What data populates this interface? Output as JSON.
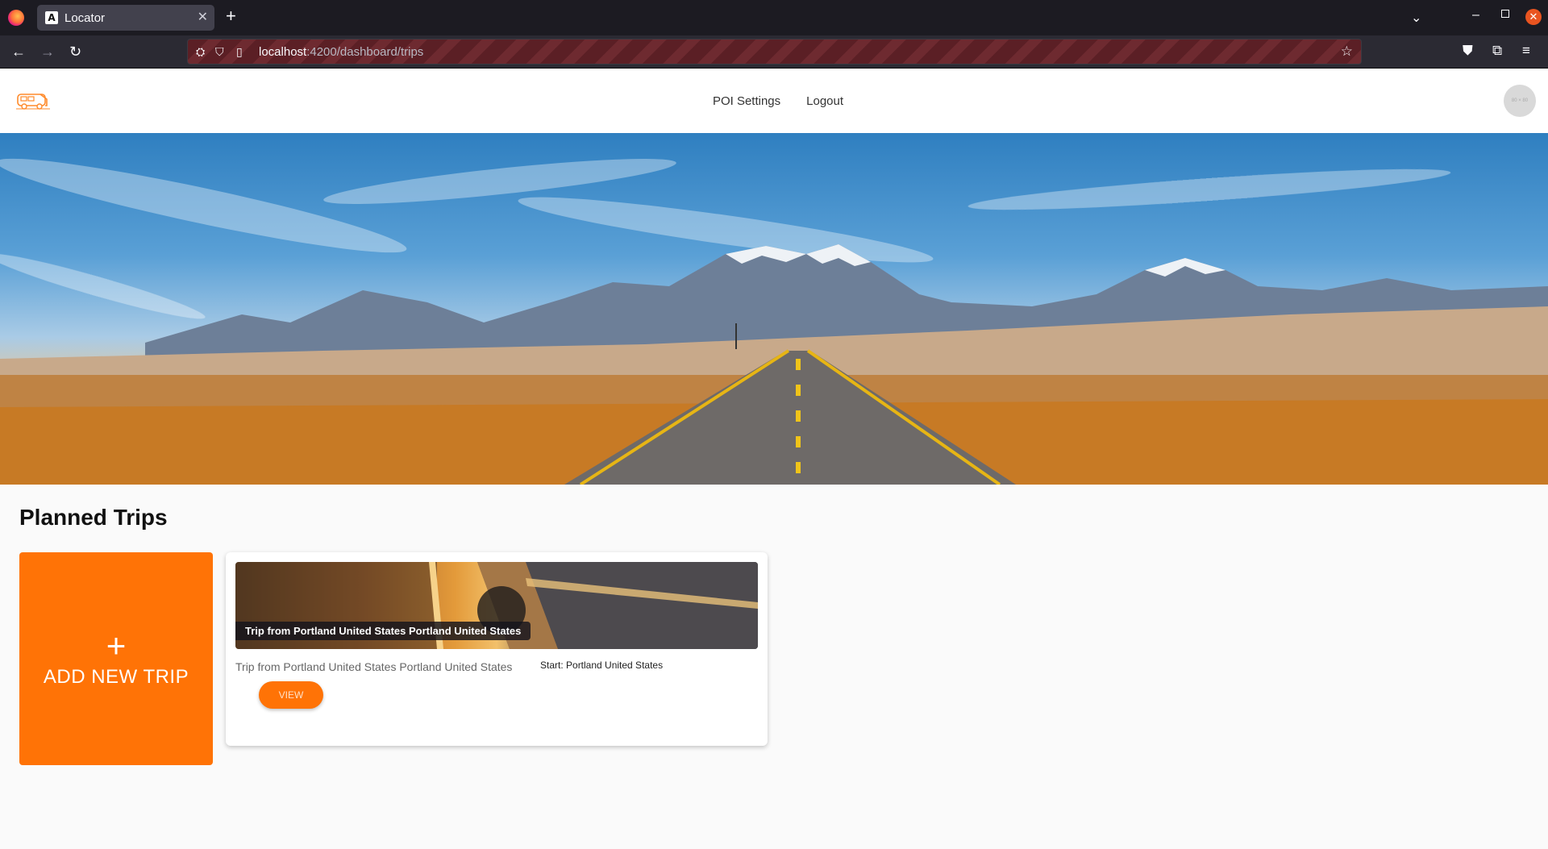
{
  "browser": {
    "tab_title": "Locator",
    "tab_favicon_letter": "A",
    "url_host": "localhost",
    "url_path": ":4200/dashboard/trips"
  },
  "header": {
    "nav": [
      {
        "label": "POI Settings"
      },
      {
        "label": "Logout"
      }
    ],
    "avatar_text": "80 × 80"
  },
  "main": {
    "title": "Planned Trips",
    "add_card": {
      "plus": "+",
      "label": "ADD NEW TRIP"
    },
    "trips": [
      {
        "overlay_title": "Trip from Portland United States Portland United States",
        "description": "Trip from Portland United States Portland United States",
        "start": "Start: Portland United States",
        "view_label": "VIEW"
      }
    ]
  },
  "colors": {
    "accent": "#ff7306",
    "header_bg": "#ffffff",
    "page_bg": "#fafafa"
  },
  "icons": {
    "browser_logo": "firefox-icon",
    "back": "arrow-left-icon",
    "forward": "arrow-right-icon",
    "reload": "reload-icon",
    "bookmark": "star-icon",
    "brand": "van-icon"
  }
}
